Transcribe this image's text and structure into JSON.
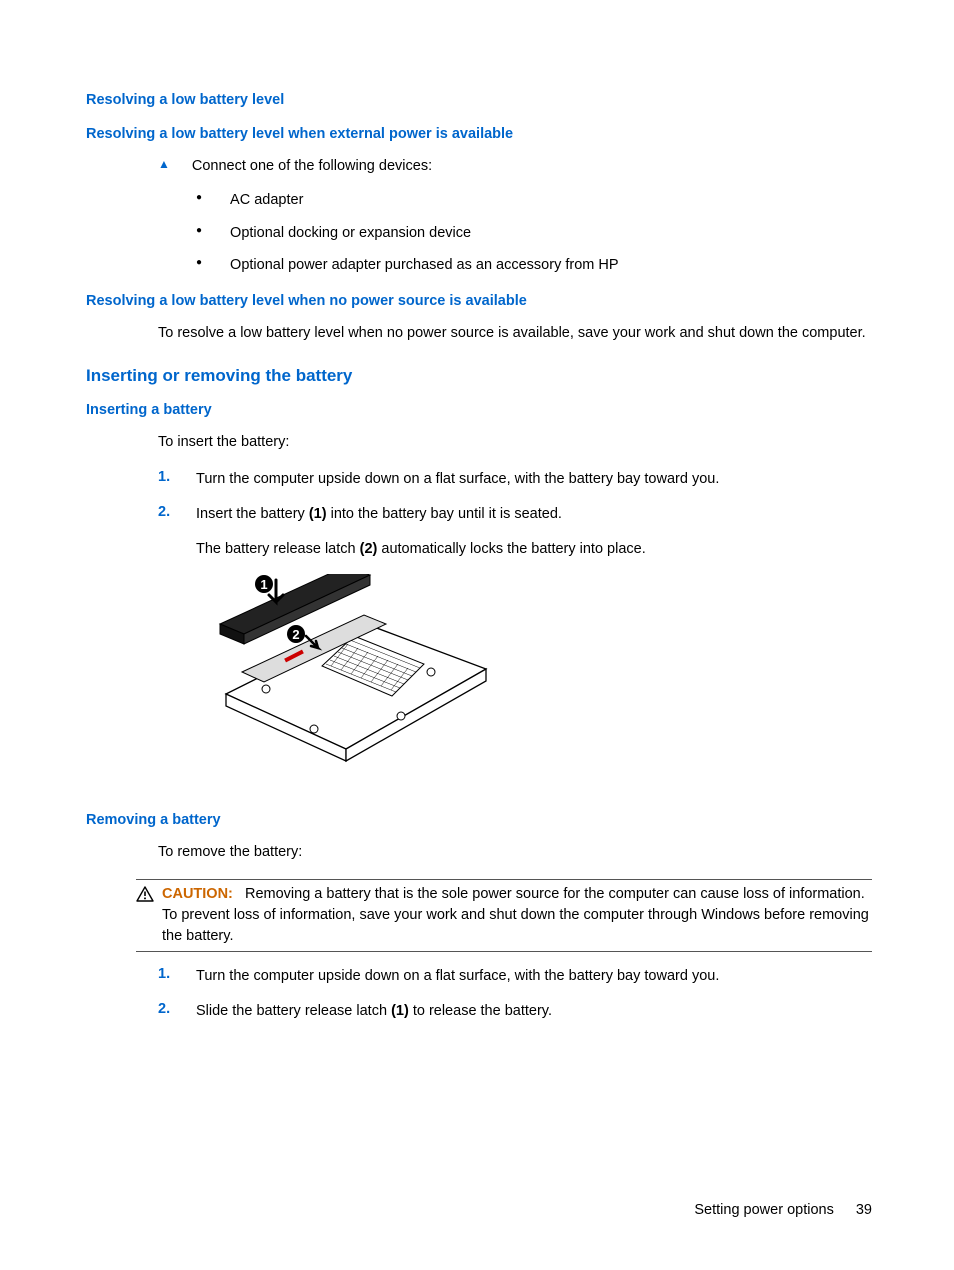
{
  "headings": {
    "resolving": "Resolving a low battery level",
    "resolving_external": "Resolving a low battery level when external power is available",
    "resolving_nopower": "Resolving a low battery level when no power source is available",
    "insert_remove": "Inserting or removing the battery",
    "inserting": "Inserting a battery",
    "removing": "Removing a battery"
  },
  "connect_lead": "Connect one of the following devices:",
  "connect_items": {
    "a": "AC adapter",
    "b": "Optional docking or expansion device",
    "c": "Optional power adapter purchased as an accessory from HP"
  },
  "nopower_text": "To resolve a low battery level when no power source is available, save your work and shut down the computer.",
  "insert_lead": "To insert the battery:",
  "insert_steps": {
    "s1_num": "1.",
    "s1_text": "Turn the computer upside down on a flat surface, with the battery bay toward you.",
    "s2_num": "2.",
    "s2_text_a": "Insert the battery ",
    "s2_text_b": "(1)",
    "s2_text_c": " into the battery bay until it is seated.",
    "s2_sub_a": "The battery release latch ",
    "s2_sub_b": "(2)",
    "s2_sub_c": " automatically locks the battery into place."
  },
  "remove_lead": "To remove the battery:",
  "caution": {
    "label": "CAUTION:",
    "text": "Removing a battery that is the sole power source for the computer can cause loss of information. To prevent loss of information, save your work and shut down the computer through Windows before removing the battery."
  },
  "remove_steps": {
    "s1_num": "1.",
    "s1_text": "Turn the computer upside down on a flat surface, with the battery bay toward you.",
    "s2_num": "2.",
    "s2_text_a": "Slide the battery release latch ",
    "s2_text_b": "(1)",
    "s2_text_c": " to release the battery."
  },
  "footer": {
    "section": "Setting power options",
    "page": "39"
  }
}
